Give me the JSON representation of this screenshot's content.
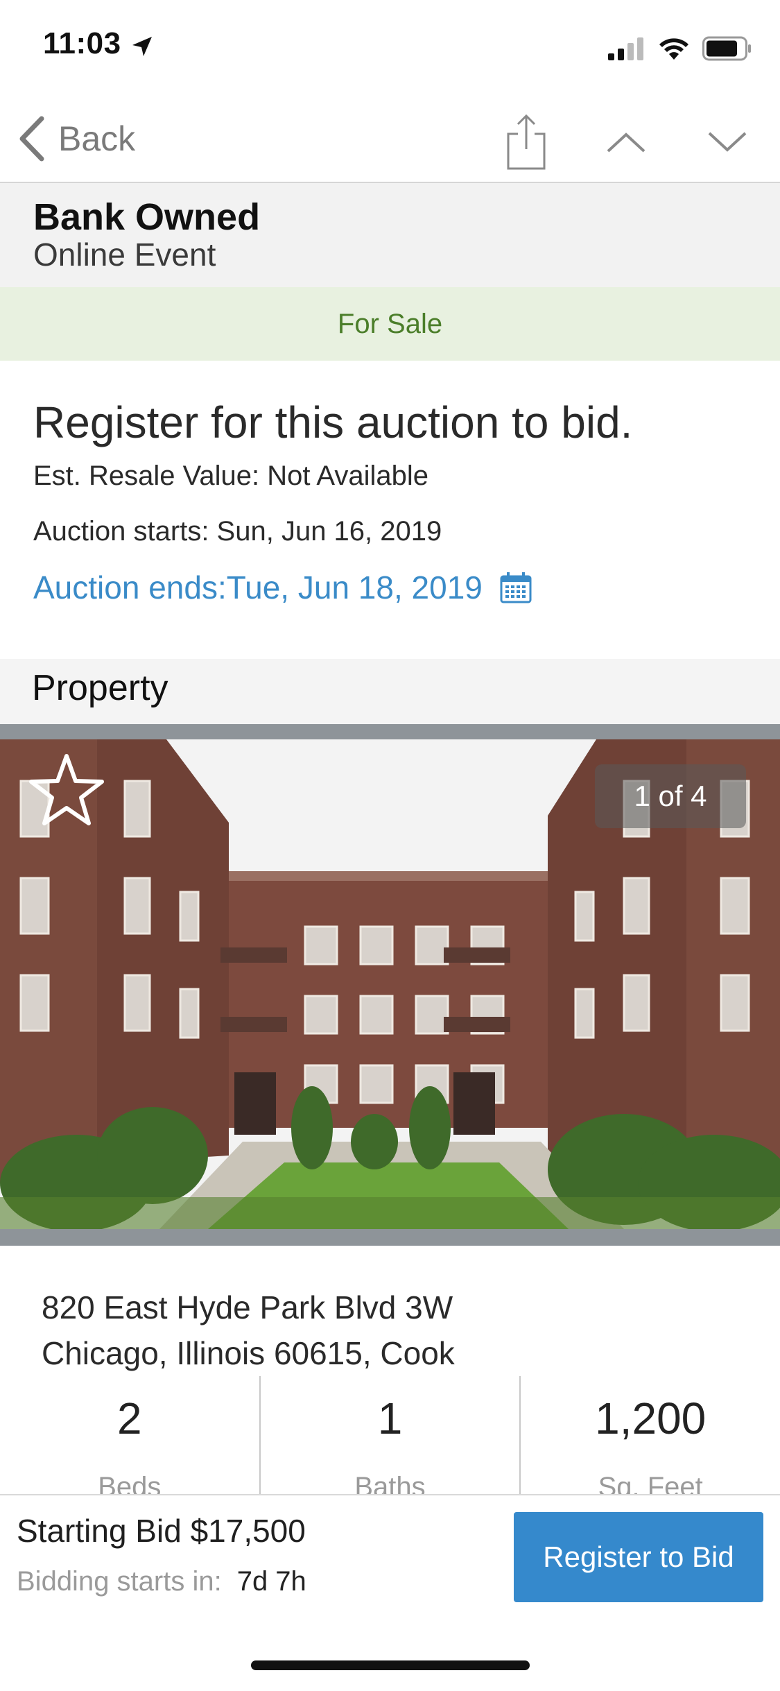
{
  "status_bar": {
    "time": "11:03"
  },
  "nav": {
    "back_label": "Back"
  },
  "event": {
    "type": "Bank Owned",
    "subtitle": "Online Event",
    "status": "For Sale"
  },
  "auction": {
    "register_prompt": "Register for this auction to bid.",
    "resale": "Est. Resale Value: Not Available",
    "starts": "Auction starts:  Sun, Jun 16, 2019",
    "ends": "Auction ends:Tue, Jun 18, 2019"
  },
  "property": {
    "section_title": "Property",
    "photo_counter": "1 of 4",
    "address_line1": "820 East Hyde Park Blvd 3W",
    "address_line2": "Chicago, Illinois 60615, Cook",
    "stats": [
      {
        "value": "2",
        "label": "Beds"
      },
      {
        "value": "1",
        "label": "Baths"
      },
      {
        "value": "1,200",
        "label": "Sq. Feet"
      }
    ]
  },
  "bottom_bar": {
    "starting_bid": "Starting Bid $17,500",
    "bidding_label": "Bidding starts in:",
    "bidding_value": "7d 7h",
    "register_button": "Register to Bid"
  },
  "colors": {
    "accent": "#3589cc",
    "sale_band_bg": "#e8f1e0",
    "sale_text": "#4b7e2a",
    "link_blue": "#3a8bc8"
  }
}
